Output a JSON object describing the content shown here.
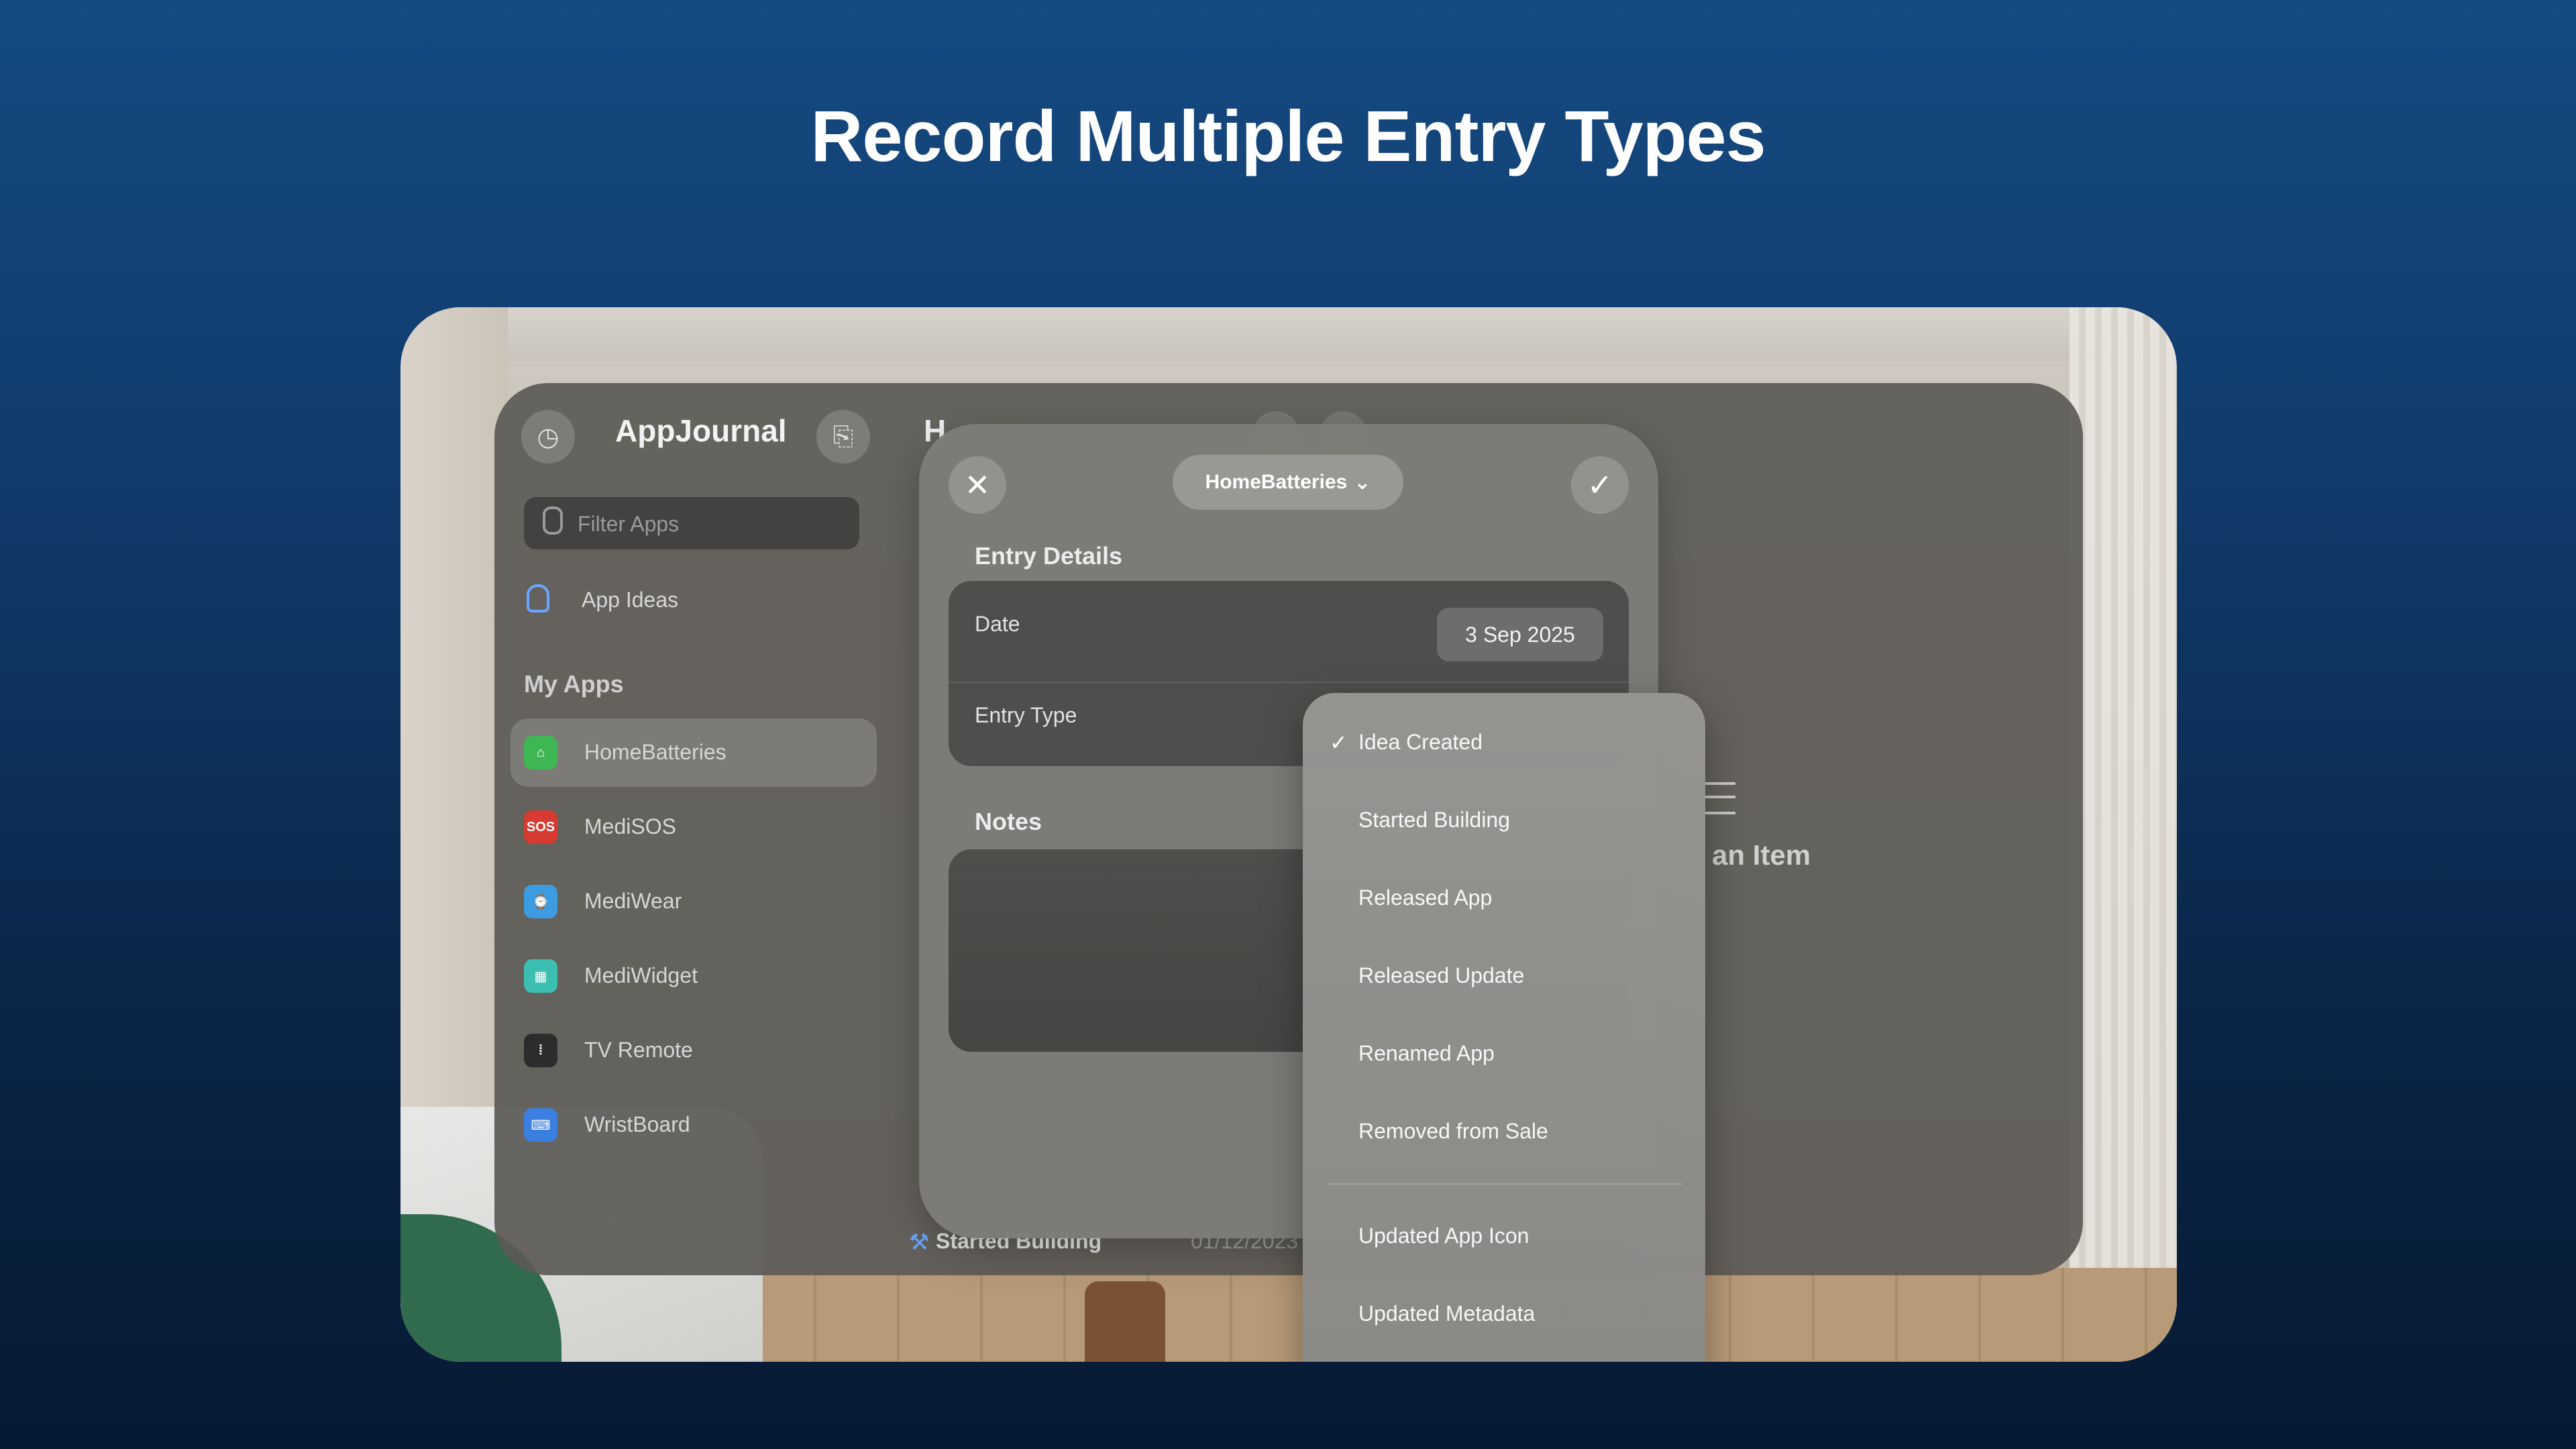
{
  "headline": "Record Multiple Entry Types",
  "sidebar": {
    "app_title": "AppJournal",
    "filter_placeholder": "Filter Apps",
    "ideas_label": "App Ideas",
    "section_title": "My Apps",
    "items": [
      {
        "label": "HomeBatteries",
        "icon": "home-icon",
        "color": "#3fb654",
        "glyph": "⌂",
        "selected": true
      },
      {
        "label": "MediSOS",
        "icon": "sos-icon",
        "color": "#d63a30",
        "glyph": "SOS",
        "selected": false
      },
      {
        "label": "MediWear",
        "icon": "watch-icon",
        "color": "#3d9be0",
        "glyph": "⌚",
        "selected": false
      },
      {
        "label": "MediWidget",
        "icon": "widget-icon",
        "color": "#3cbfb0",
        "glyph": "▦",
        "selected": false
      },
      {
        "label": "TV Remote",
        "icon": "remote-icon",
        "color": "#2c2c2c",
        "glyph": "⁞",
        "selected": false
      },
      {
        "label": "WristBoard",
        "icon": "keyboard-icon",
        "color": "#3b7fe0",
        "glyph": "⌨",
        "selected": false
      }
    ]
  },
  "main": {
    "partial_title": "H",
    "empty_text": "an Item",
    "bg_entry": {
      "label": "Started Building",
      "date": "01/12/2023"
    }
  },
  "sheet": {
    "close_glyph": "✕",
    "confirm_glyph": "✓",
    "app_picker": "HomeBatteries",
    "picker_chevron": "⌄",
    "entry_details_title": "Entry Details",
    "date_label": "Date",
    "date_value": "3 Sep 2025",
    "entry_type_label": "Entry Type",
    "notes_title": "Notes"
  },
  "menu": {
    "check_glyph": "✓",
    "items": [
      {
        "label": "Idea Created",
        "checked": true
      },
      {
        "label": "Started Building",
        "checked": false
      },
      {
        "label": "Released App",
        "checked": false
      },
      {
        "label": "Released Update",
        "checked": false
      },
      {
        "label": "Renamed App",
        "checked": false
      },
      {
        "label": "Removed from Sale",
        "checked": false
      },
      {
        "label": "Updated App Icon",
        "checked": false
      },
      {
        "label": "Updated Metadata",
        "checked": false
      }
    ]
  }
}
